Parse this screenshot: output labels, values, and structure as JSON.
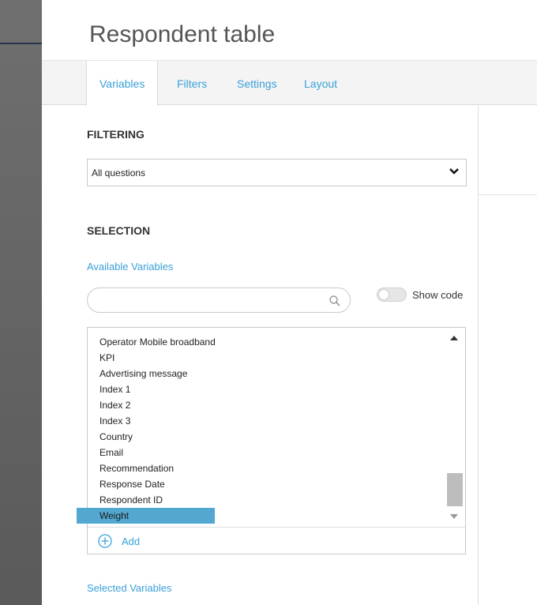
{
  "header": {
    "title": "Respondent table"
  },
  "tabs": [
    {
      "label": "Variables",
      "active": true
    },
    {
      "label": "Filters",
      "active": false
    },
    {
      "label": "Settings",
      "active": false
    },
    {
      "label": "Layout",
      "active": false
    }
  ],
  "filtering": {
    "heading": "FILTERING",
    "select_value": "All questions"
  },
  "selection": {
    "heading": "SELECTION",
    "available_label": "Available Variables",
    "search_placeholder": "",
    "search_value": "",
    "show_code_label": "Show code",
    "show_code_on": false,
    "items": [
      "Operator Mobile broadband",
      "KPI",
      "Advertising message",
      "Index 1",
      "Index 2",
      "Index 3",
      "Country",
      "Email",
      "Recommendation",
      "Response Date",
      "Respondent ID",
      "Weight"
    ],
    "selected_item": "Weight",
    "add_label": "Add",
    "selected_variables_label": "Selected Variables"
  },
  "colors": {
    "accent": "#3aa0d8",
    "selection_highlight": "#52a8d1",
    "tab_bar_bg": "#f4f4f4"
  }
}
